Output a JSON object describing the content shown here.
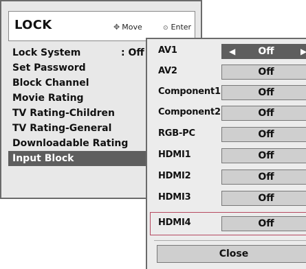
{
  "main_menu": {
    "title": "LOCK",
    "hint_move": "Move",
    "hint_enter": "Enter",
    "items": [
      {
        "label": "Lock System",
        "value": ": Off"
      },
      {
        "label": "Set Password"
      },
      {
        "label": "Block Channel"
      },
      {
        "label": "Movie Rating"
      },
      {
        "label": "TV Rating-Children"
      },
      {
        "label": "TV Rating-General"
      },
      {
        "label": "Downloadable Rating"
      },
      {
        "label": "Input Block"
      }
    ],
    "selected": "Input Block"
  },
  "input_block": {
    "items": [
      {
        "label": "AV1",
        "value": "Off"
      },
      {
        "label": "AV2",
        "value": "Off"
      },
      {
        "label": "Component1",
        "value": "Off"
      },
      {
        "label": "Component2",
        "value": "Off"
      },
      {
        "label": "RGB-PC",
        "value": "Off"
      },
      {
        "label": "HDMI1",
        "value": "Off"
      },
      {
        "label": "HDMI2",
        "value": "Off"
      },
      {
        "label": "HDMI3",
        "value": "Off"
      },
      {
        "label": "HDMI4",
        "value": "Off"
      }
    ],
    "active_value_row": "AV1",
    "focused_row": "HDMI4",
    "close_label": "Close"
  },
  "icons": {
    "move": "four-way-arrow-icon",
    "enter": "circle-dot-icon",
    "left": "triangle-left-icon",
    "right": "triangle-right-icon"
  },
  "colors": {
    "panel_bg": "#e8e8e8",
    "selected_bg": "#5e5e5e",
    "value_box_bg": "#cfcfcf",
    "focus_border": "#b5475e"
  }
}
